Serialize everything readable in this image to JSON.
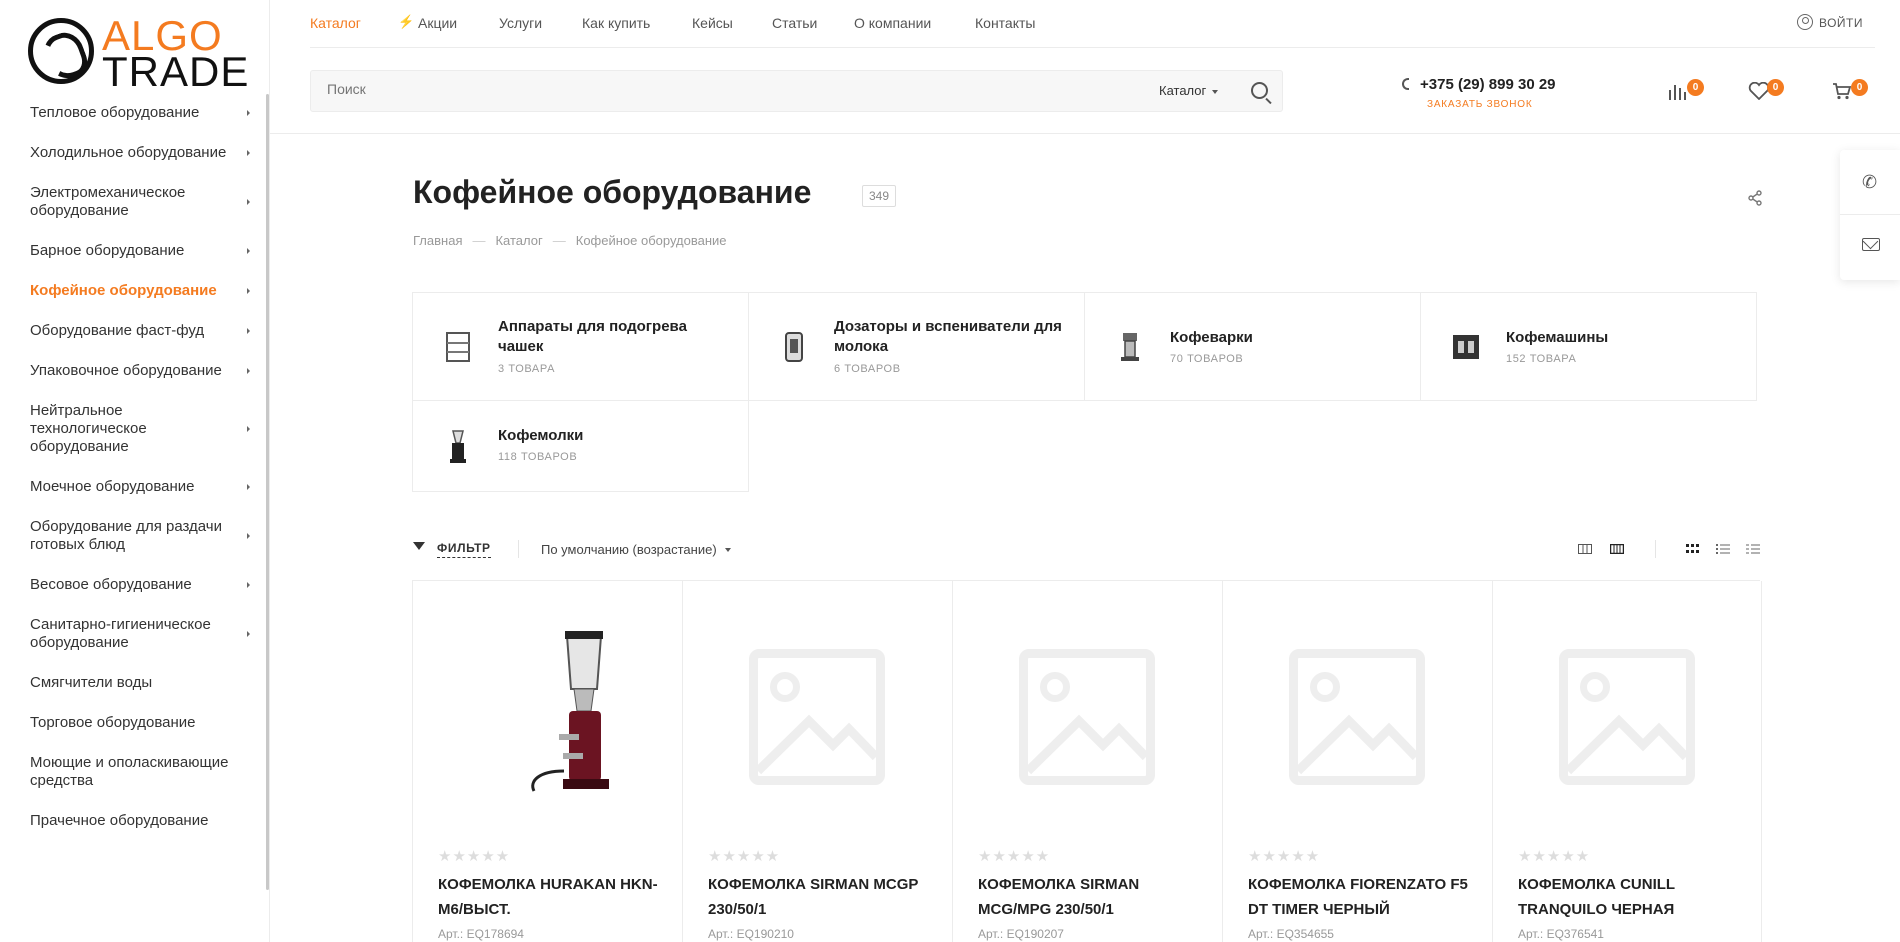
{
  "logo": {
    "line1": "ALGO",
    "line2": "TRADE"
  },
  "sidebar": {
    "items": [
      {
        "label": "Тепловое оборудование",
        "arrow": true
      },
      {
        "label": "Холодильное оборудование",
        "arrow": true
      },
      {
        "label": "Электромеханическое оборудование",
        "arrow": true
      },
      {
        "label": "Барное оборудование",
        "arrow": true
      },
      {
        "label": "Кофейное оборудование",
        "arrow": true,
        "active": true
      },
      {
        "label": "Оборудование фаст-фуд",
        "arrow": true
      },
      {
        "label": "Упаковочное оборудование",
        "arrow": true
      },
      {
        "label": "Нейтральное технологическое оборудование",
        "arrow": true
      },
      {
        "label": "Моечное оборудование",
        "arrow": true
      },
      {
        "label": "Оборудование для раздачи готовых блюд",
        "arrow": true
      },
      {
        "label": "Весовое оборудование",
        "arrow": true
      },
      {
        "label": "Санитарно-гигиеническое оборудование",
        "arrow": true
      },
      {
        "label": "Смягчители воды",
        "arrow": false
      },
      {
        "label": "Торговое оборудование",
        "arrow": false
      },
      {
        "label": "Моющие и ополаскивающие средства",
        "arrow": false
      },
      {
        "label": "Прачечное оборудование",
        "arrow": false
      }
    ]
  },
  "topnav": {
    "items": [
      {
        "label": "Каталог",
        "active": true
      },
      {
        "label": "Акции",
        "active": false
      },
      {
        "label": "Услуги",
        "active": false
      },
      {
        "label": "Как купить",
        "active": false
      },
      {
        "label": "Кейсы",
        "active": false
      },
      {
        "label": "Статьи",
        "active": false
      },
      {
        "label": "О компании",
        "active": false
      },
      {
        "label": "Контакты",
        "active": false
      }
    ],
    "login": "ВОЙТИ"
  },
  "search": {
    "placeholder": "Поиск",
    "category": "Каталог"
  },
  "contact": {
    "phone": "+375 (29) 899 30 29",
    "callback": "ЗАКАЗАТЬ ЗВОНОК"
  },
  "header_icons": {
    "compare_count": "0",
    "favorites_count": "0",
    "cart_count": "0"
  },
  "page": {
    "title": "Кофейное оборудование",
    "count": "349",
    "breadcrumbs": [
      "Главная",
      "Каталог",
      "Кофейное оборудование"
    ]
  },
  "categories": [
    {
      "name": "Аппараты для подогрева чашек",
      "count": "3 ТОВАРА"
    },
    {
      "name": "Дозаторы и вспениватели для молока",
      "count": "6 ТОВАРОВ"
    },
    {
      "name": "Кофеварки",
      "count": "70 ТОВАРОВ"
    },
    {
      "name": "Кофемашины",
      "count": "152 ТОВАРА"
    },
    {
      "name": "Кофемолки",
      "count": "118 ТОВАРОВ"
    }
  ],
  "toolbar": {
    "filter_label": "ФИЛЬТР",
    "sort_label": "По умолчанию (возрастание)"
  },
  "products": [
    {
      "name": "КОФЕМОЛКА HURAKAN HKN-M6/ВЫСТ.",
      "article": "Арт.: EQ178694",
      "has_image": true
    },
    {
      "name": "КОФЕМОЛКА SIRMAN MCGP 230/50/1",
      "article": "Арт.: EQ190210",
      "has_image": false
    },
    {
      "name": "КОФЕМОЛКА SIRMAN MCG/MPG 230/50/1",
      "article": "Арт.: EQ190207",
      "has_image": false
    },
    {
      "name": "КОФЕМОЛКА FIORENZATO F5 DT TIMER ЧЕРНЫЙ",
      "article": "Арт.: EQ354655",
      "has_image": false
    },
    {
      "name": "КОФЕМОЛКА CUNILL TRANQUILO ЧЕРНАЯ",
      "article": "Арт.: EQ376541",
      "has_image": false
    }
  ],
  "colors": {
    "accent": "#f47b20",
    "text": "#222222",
    "muted": "#999999",
    "border": "#ececec"
  }
}
